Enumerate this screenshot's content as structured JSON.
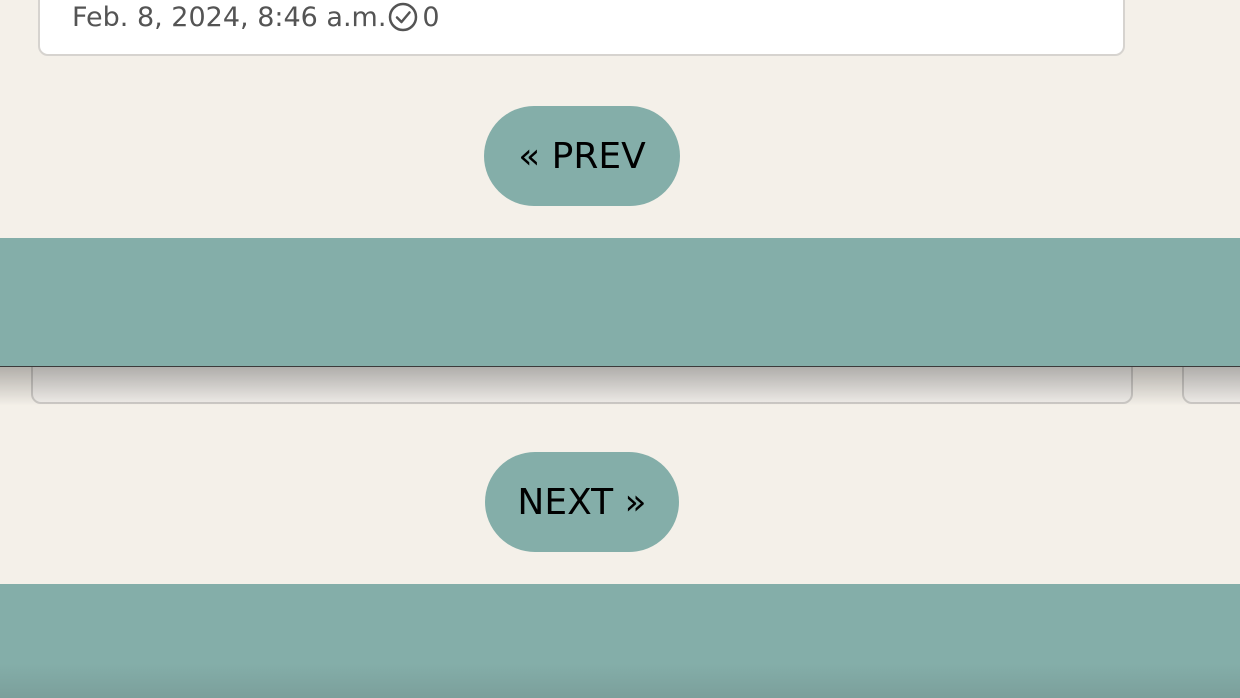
{
  "post": {
    "timestamp": "Feb. 8, 2024, 8:46 a.m.",
    "check_count": "0"
  },
  "pagination": {
    "prev_label": "« PREV",
    "next_label": "NEXT »"
  },
  "icons": {
    "check": "check-circle-icon"
  },
  "colors": {
    "page_background": "#f4f0e9",
    "accent_teal": "#84aea9",
    "card_background": "#ffffff"
  }
}
